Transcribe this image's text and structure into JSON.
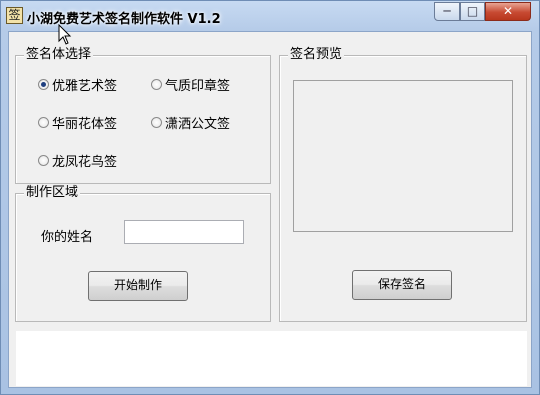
{
  "window": {
    "title": "小湖免费艺术签名制作软件 V1.2",
    "icon_glyph": "签",
    "icon_name": "signature-app-icon",
    "controls": {
      "minimize": "─",
      "maximize": "□",
      "close": "✕"
    }
  },
  "style_group": {
    "label": "签名体选择",
    "options": [
      {
        "label": "优雅艺术签",
        "checked": true
      },
      {
        "label": "气质印章签",
        "checked": false
      },
      {
        "label": "华丽花体签",
        "checked": false
      },
      {
        "label": "潇洒公文签",
        "checked": false
      },
      {
        "label": "龙凤花鸟签",
        "checked": false
      }
    ]
  },
  "make_group": {
    "label": "制作区域",
    "name_label": "你的姓名",
    "name_value": "",
    "start_button": "开始制作"
  },
  "preview_group": {
    "label": "签名预览",
    "save_button": "保存签名"
  },
  "colors": {
    "title_gradient_top": "#c7daf2",
    "close_button": "#c74a32",
    "client_bg": "#f0f0f0"
  }
}
